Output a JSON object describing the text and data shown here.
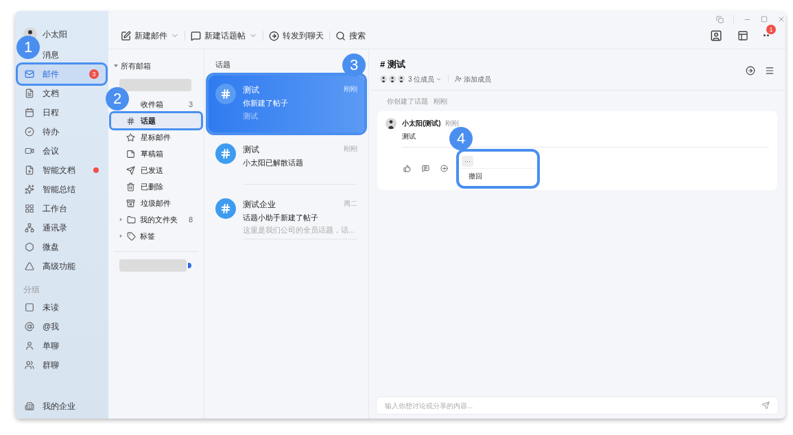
{
  "sidebar": {
    "user": {
      "name": "小太阳"
    },
    "nav": [
      {
        "label": "消息",
        "selected": false,
        "callout": "1"
      },
      {
        "label": "邮件",
        "selected": true,
        "badge": "3",
        "highlighted": true
      },
      {
        "label": "文档",
        "selected": false
      },
      {
        "label": "日程",
        "selected": false
      },
      {
        "label": "待办",
        "selected": false
      },
      {
        "label": "会议",
        "selected": false
      },
      {
        "label": "智能文档",
        "selected": false,
        "color": "#f0504a"
      },
      {
        "label": "智能总结",
        "selected": false
      },
      {
        "label": "工作台",
        "selected": false
      },
      {
        "label": "通讯录",
        "selected": false
      },
      {
        "label": "微盘",
        "selected": false
      },
      {
        "label": "高级功能",
        "selected": false
      }
    ],
    "group_title": "分组",
    "groups": [
      {
        "label": "未读"
      },
      {
        "label": "@我"
      },
      {
        "label": "单聊"
      },
      {
        "label": "群聊"
      }
    ],
    "footer": {
      "label": "我的企业"
    }
  },
  "toolbar": {
    "buttons": [
      {
        "label": "新建邮件",
        "dropdown": true
      },
      {
        "label": "新建话题帖",
        "dropdown": true
      },
      {
        "label": "转发到聊天",
        "dropdown": false
      },
      {
        "label": "搜索",
        "dropdown": false
      }
    ],
    "more_badge": "1"
  },
  "folders": {
    "header": "所有邮箱",
    "expanded": true,
    "items": [
      {
        "label": "收件箱",
        "count": "3",
        "selected": false,
        "callout": "2"
      },
      {
        "label": "话题",
        "selected": true,
        "highlighted": true
      },
      {
        "label": "星标邮件",
        "selected": false
      },
      {
        "label": "草稿箱",
        "selected": false
      },
      {
        "label": "已发送",
        "selected": false
      },
      {
        "label": "已删除",
        "selected": false
      },
      {
        "label": "垃圾邮件",
        "selected": false
      }
    ],
    "groups": [
      {
        "label": "我的文件夹",
        "count": "8",
        "expanded": false
      },
      {
        "label": "标签",
        "expanded": false
      }
    ]
  },
  "topics": {
    "header": "话题",
    "callout": "3",
    "items": [
      {
        "title": "测试",
        "time": "刚刚",
        "subtitle": "你新建了帖子",
        "preview": "测试",
        "selected": true
      },
      {
        "title": "测试",
        "time": "刚刚",
        "subtitle": "小太阳已解散话题",
        "selected": false
      },
      {
        "title": "测试企业",
        "time": "周二",
        "subtitle": "话题小助手新建了帖子",
        "preview": "这里是我们公司的全员话题，话...",
        "selected": false
      }
    ]
  },
  "detail": {
    "hash": "#",
    "title": "测试",
    "members": "3 位成员",
    "add_member": "添加成员",
    "system_note": {
      "text": "你创建了话题",
      "time": "刚刚"
    },
    "post": {
      "author": "小太阳(测试)",
      "time": "刚刚",
      "body": "测试",
      "more": "···",
      "menu_open": true,
      "callout": "4",
      "menu": [
        "撤回"
      ]
    },
    "composer": {
      "placeholder": "输入你想讨论或分享的内容..."
    }
  }
}
